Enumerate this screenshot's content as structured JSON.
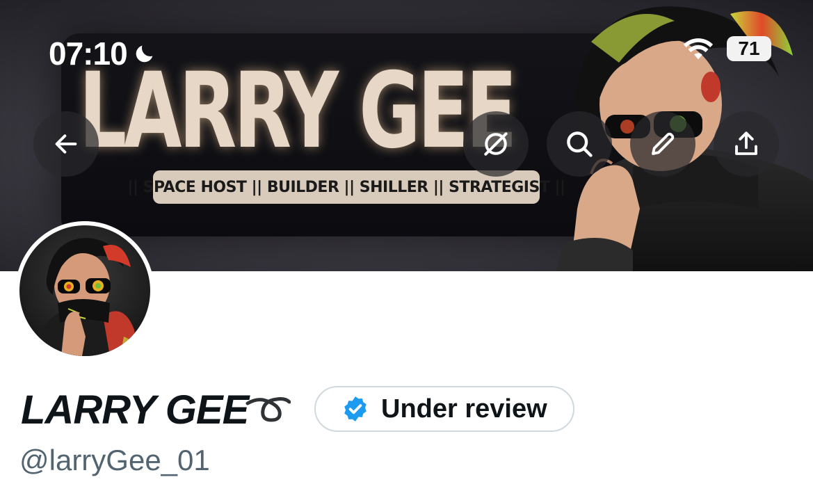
{
  "status_bar": {
    "time": "07:10",
    "battery": "71",
    "icons": [
      "moon-icon",
      "wifi-icon",
      "battery-icon"
    ]
  },
  "banner": {
    "title": "LARRY GEE",
    "tagline": "|| SPACE HOST || BUILDER || SHILLER || STRATEGIST ||"
  },
  "actions": {
    "back": "back-arrow-icon",
    "grok": "grok-icon",
    "search": "search-icon",
    "edit": "pencil-icon",
    "share": "share-icon"
  },
  "profile": {
    "display_name": "LARRY GEE",
    "name_emoji": "➰",
    "verification_label": "Under review",
    "handle": "@larryGee_01"
  },
  "colors": {
    "verified_blue": "#1d9bf0",
    "name_text": "#0f1419",
    "handle_text": "#536471",
    "badge_border": "#cfd9de"
  }
}
